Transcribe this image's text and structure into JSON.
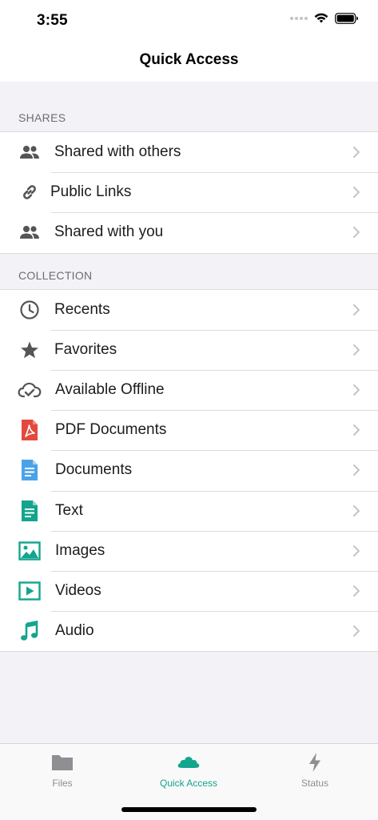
{
  "status_bar": {
    "time": "3:55"
  },
  "nav": {
    "title": "Quick Access"
  },
  "sections": {
    "shares": {
      "header": "SHARES",
      "items": [
        {
          "label": "Shared with others",
          "icon": "people-icon"
        },
        {
          "label": "Public Links",
          "icon": "link-icon"
        },
        {
          "label": "Shared with you",
          "icon": "people-icon"
        }
      ]
    },
    "collection": {
      "header": "COLLECTION",
      "items": [
        {
          "label": "Recents",
          "icon": "clock-icon"
        },
        {
          "label": "Favorites",
          "icon": "star-icon"
        },
        {
          "label": "Available Offline",
          "icon": "cloud-check-icon"
        },
        {
          "label": "PDF Documents",
          "icon": "pdf-icon"
        },
        {
          "label": "Documents",
          "icon": "document-icon"
        },
        {
          "label": "Text",
          "icon": "text-file-icon"
        },
        {
          "label": "Images",
          "icon": "image-icon"
        },
        {
          "label": "Videos",
          "icon": "video-icon"
        },
        {
          "label": "Audio",
          "icon": "music-note-icon"
        }
      ]
    }
  },
  "tabs": [
    {
      "label": "Files",
      "icon": "folder-icon",
      "active": false
    },
    {
      "label": "Quick Access",
      "icon": "owncloud-icon",
      "active": true
    },
    {
      "label": "Status",
      "icon": "bolt-icon",
      "active": false
    }
  ],
  "colors": {
    "accent": "#13a58d",
    "icon_gray": "#555555",
    "pdf_red": "#e34a3d",
    "doc_blue": "#4aa3e8",
    "text_green": "#13a58d",
    "chevron": "#c4c4c7",
    "tab_inactive": "#8e8e93"
  }
}
